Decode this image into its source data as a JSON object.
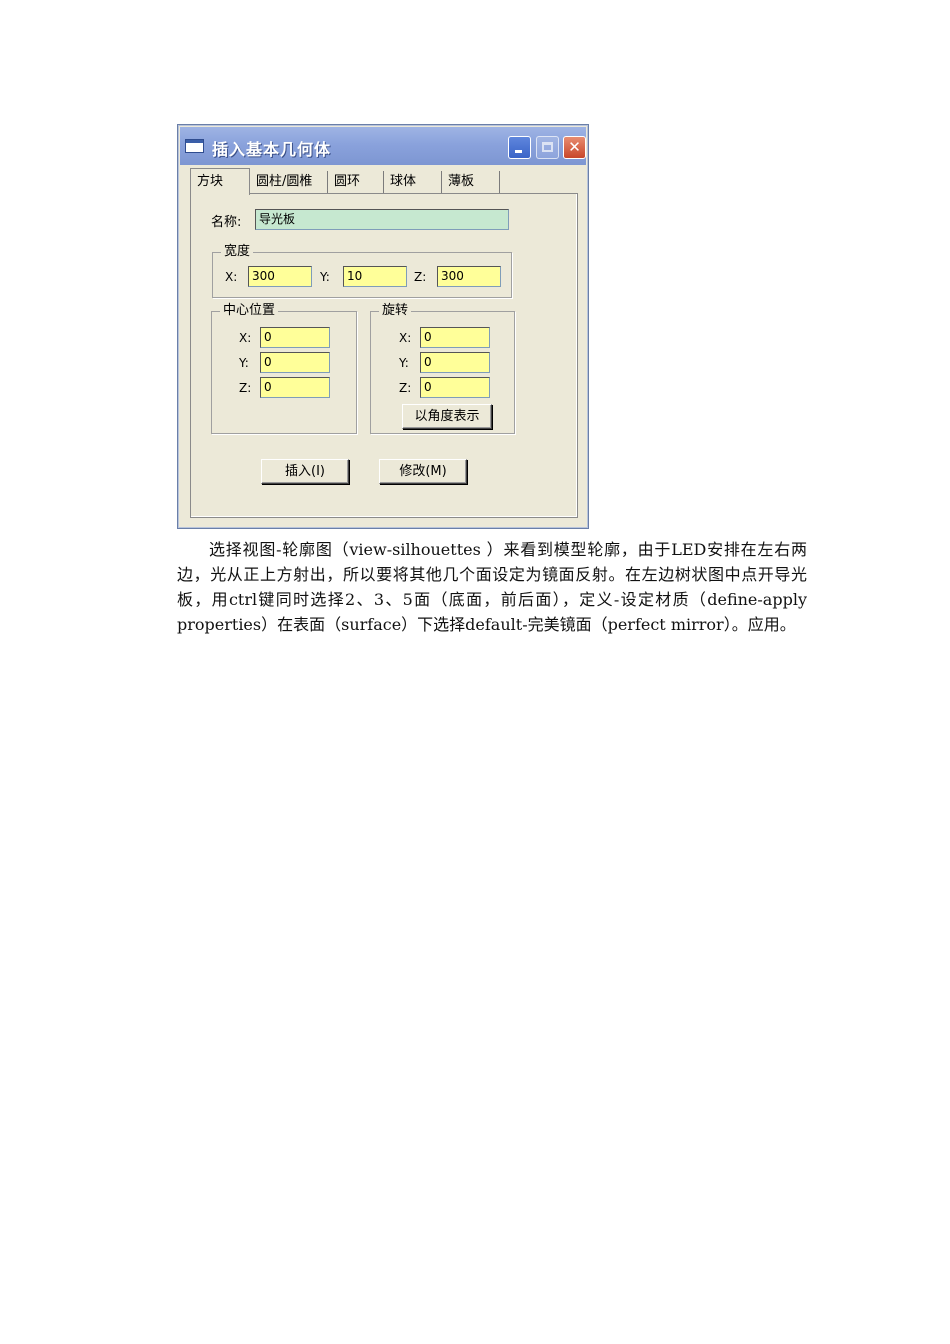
{
  "dialog": {
    "title": "插入基本几何体",
    "tabs": [
      "方块",
      "圆柱/圆椎",
      "圆环",
      "球体",
      "薄板"
    ],
    "name_label": "名称:",
    "name_value": "导光板",
    "width_group": {
      "title": "宽度",
      "x_label": "X:",
      "x_value": "300",
      "y_label": "Y:",
      "y_value": "10",
      "z_label": "Z:",
      "z_value": "300"
    },
    "center_group": {
      "title": "中心位置",
      "x_label": "X:",
      "x_value": "0",
      "y_label": "Y:",
      "y_value": "0",
      "z_label": "Z:",
      "z_value": "0"
    },
    "rotation_group": {
      "title": "旋转",
      "x_label": "X:",
      "x_value": "0",
      "y_label": "Y:",
      "y_value": "0",
      "z_label": "Z:",
      "z_value": "0",
      "degrees_button": "以角度表示"
    },
    "insert_button": "插入(I)",
    "modify_button": "修改(M)"
  },
  "body_text": "选择视图-轮廓图（view-silhouettes ）来看到模型轮廓，由于LED安排在左右两边，光从正上方射出，所以要将其他几个面设定为镜面反射。在左边树状图中点开导光板，用ctrl键同时选择2、3、5面（底面，前后面），定义-设定材质（define-apply properties）在表面（surface）下选择default-完美镜面（perfect mirror）。应用。"
}
